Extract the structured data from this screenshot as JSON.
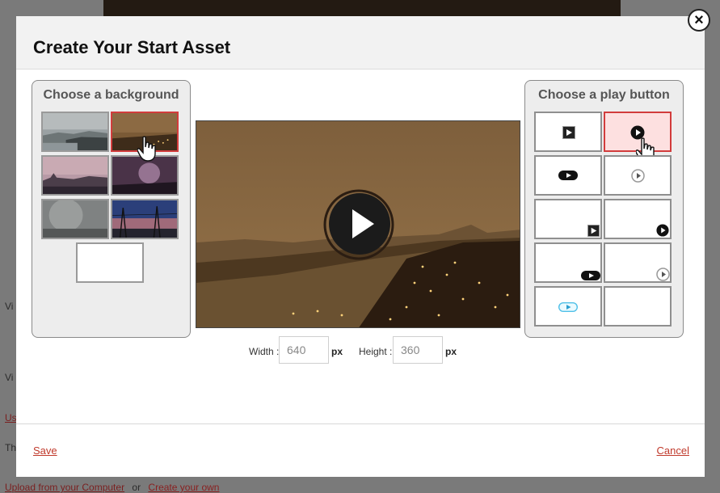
{
  "background_page": {
    "labels": [
      "Vi",
      "Vi",
      "Th"
    ],
    "upload_link": "Upload from your Computer",
    "or_text": "or",
    "create_link": "Create your own",
    "us_link": "Us"
  },
  "modal": {
    "title": "Create Your Start Asset",
    "close_label": "×",
    "background_panel": {
      "title": "Choose a background",
      "thumbnails": [
        {
          "name": "foggy-river-skyline",
          "selected": false
        },
        {
          "name": "night-city-river",
          "selected": true
        },
        {
          "name": "dusk-city-skyline",
          "selected": false
        },
        {
          "name": "purple-lightning-city",
          "selected": false
        },
        {
          "name": "gray-storm-sky",
          "selected": false
        },
        {
          "name": "power-lines-sunset",
          "selected": false
        },
        {
          "name": "blank",
          "selected": false
        }
      ]
    },
    "play_button_panel": {
      "title": "Choose a play button",
      "options": [
        {
          "name": "square-play",
          "position": "center",
          "selected": false
        },
        {
          "name": "circle-play",
          "position": "center",
          "selected": true
        },
        {
          "name": "pill-play",
          "position": "center",
          "selected": false
        },
        {
          "name": "outline-circle-play",
          "position": "center",
          "selected": false
        },
        {
          "name": "square-play",
          "position": "bottom-right",
          "selected": false
        },
        {
          "name": "circle-play",
          "position": "bottom-right",
          "selected": false
        },
        {
          "name": "pill-play",
          "position": "bottom-right",
          "selected": false
        },
        {
          "name": "outline-circle-play",
          "position": "bottom-right",
          "selected": false
        },
        {
          "name": "blue-pill-play",
          "position": "center",
          "selected": false
        },
        {
          "name": "none",
          "position": "none",
          "selected": false
        }
      ]
    },
    "dimensions": {
      "width_label": "Width :",
      "width_value": "640",
      "width_unit": "px",
      "height_label": "Height :",
      "height_value": "360",
      "height_unit": "px"
    },
    "footer": {
      "save_label": "Save",
      "cancel_label": "Cancel"
    },
    "colors": {
      "accent_red": "#d23c3c",
      "link_red": "#c0392b",
      "selected_tile_bg": "#fde0e0"
    }
  }
}
